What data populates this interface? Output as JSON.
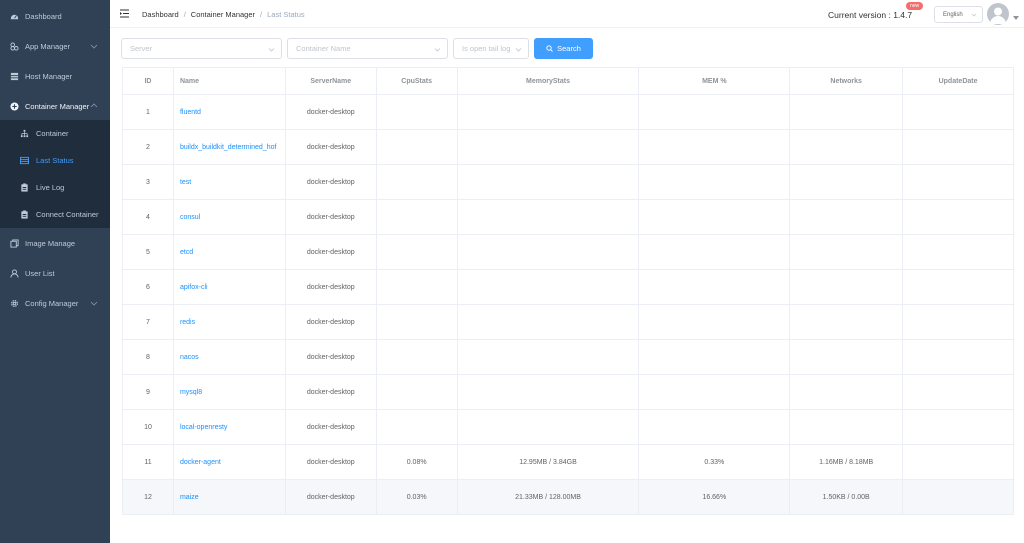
{
  "sidebar": {
    "items": [
      {
        "label": "Dashboard",
        "icon": "dashboard-icon"
      },
      {
        "label": "App Manager",
        "icon": "apps-icon"
      },
      {
        "label": "Host Manager",
        "icon": "server-icon"
      },
      {
        "label": "Container Manager",
        "icon": "plus-circle-icon"
      },
      {
        "label": "Container",
        "icon": "tree-icon"
      },
      {
        "label": "Last Status",
        "icon": "table-icon"
      },
      {
        "label": "Live Log",
        "icon": "clipboard-icon"
      },
      {
        "label": "Connect Container",
        "icon": "clipboard-icon"
      },
      {
        "label": "Image Manage",
        "icon": "copy-icon"
      },
      {
        "label": "User List",
        "icon": "user-icon"
      },
      {
        "label": "Config Manager",
        "icon": "gear-icon"
      }
    ]
  },
  "header": {
    "breadcrumb": [
      "Dashboard",
      "Container Manager",
      "Last Status"
    ],
    "version_label": "Current version : 1.4.7",
    "badge": "new",
    "language": "English"
  },
  "filters": {
    "server_placeholder": "Server",
    "container_placeholder": "Container Name",
    "tail_placeholder": "Is open tail log",
    "search_label": "Search"
  },
  "table": {
    "columns": [
      "ID",
      "Name",
      "ServerName",
      "CpuStats",
      "MemoryStats",
      "MEM %",
      "Networks",
      "UpdateDate"
    ],
    "rows": [
      {
        "id": "1",
        "name": "fluentd",
        "server": "docker-desktop",
        "cpu": "",
        "mem": "",
        "pct": "",
        "net": "",
        "date": ""
      },
      {
        "id": "2",
        "name": "buildx_buildkit_determined_hof",
        "server": "docker-desktop",
        "cpu": "",
        "mem": "",
        "pct": "",
        "net": "",
        "date": ""
      },
      {
        "id": "3",
        "name": "test",
        "server": "docker-desktop",
        "cpu": "",
        "mem": "",
        "pct": "",
        "net": "",
        "date": ""
      },
      {
        "id": "4",
        "name": "consul",
        "server": "docker-desktop",
        "cpu": "",
        "mem": "",
        "pct": "",
        "net": "",
        "date": ""
      },
      {
        "id": "5",
        "name": "etcd",
        "server": "docker-desktop",
        "cpu": "",
        "mem": "",
        "pct": "",
        "net": "",
        "date": ""
      },
      {
        "id": "6",
        "name": "apifox-cli",
        "server": "docker-desktop",
        "cpu": "",
        "mem": "",
        "pct": "",
        "net": "",
        "date": ""
      },
      {
        "id": "7",
        "name": "redis",
        "server": "docker-desktop",
        "cpu": "",
        "mem": "",
        "pct": "",
        "net": "",
        "date": ""
      },
      {
        "id": "8",
        "name": "nacos",
        "server": "docker-desktop",
        "cpu": "",
        "mem": "",
        "pct": "",
        "net": "",
        "date": ""
      },
      {
        "id": "9",
        "name": "mysql8",
        "server": "docker-desktop",
        "cpu": "",
        "mem": "",
        "pct": "",
        "net": "",
        "date": ""
      },
      {
        "id": "10",
        "name": "local-openresty",
        "server": "docker-desktop",
        "cpu": "",
        "mem": "",
        "pct": "",
        "net": "",
        "date": ""
      },
      {
        "id": "11",
        "name": "docker-agent",
        "server": "docker-desktop",
        "cpu": "0.08%",
        "mem": "12.95MB / 3.84GB",
        "pct": "0.33%",
        "net": "1.16MB / 8.18MB",
        "date": ""
      },
      {
        "id": "12",
        "name": "maize",
        "server": "docker-desktop",
        "cpu": "0.03%",
        "mem": "21.33MB / 128.00MB",
        "pct": "16.66%",
        "net": "1.50KB / 0.00B",
        "date": ""
      }
    ]
  },
  "colors": {
    "sidebar_bg": "#304156",
    "submenu_bg": "#1f2d3d",
    "accent": "#409eff",
    "link": "#1890ff",
    "badge": "#f56c6c"
  }
}
